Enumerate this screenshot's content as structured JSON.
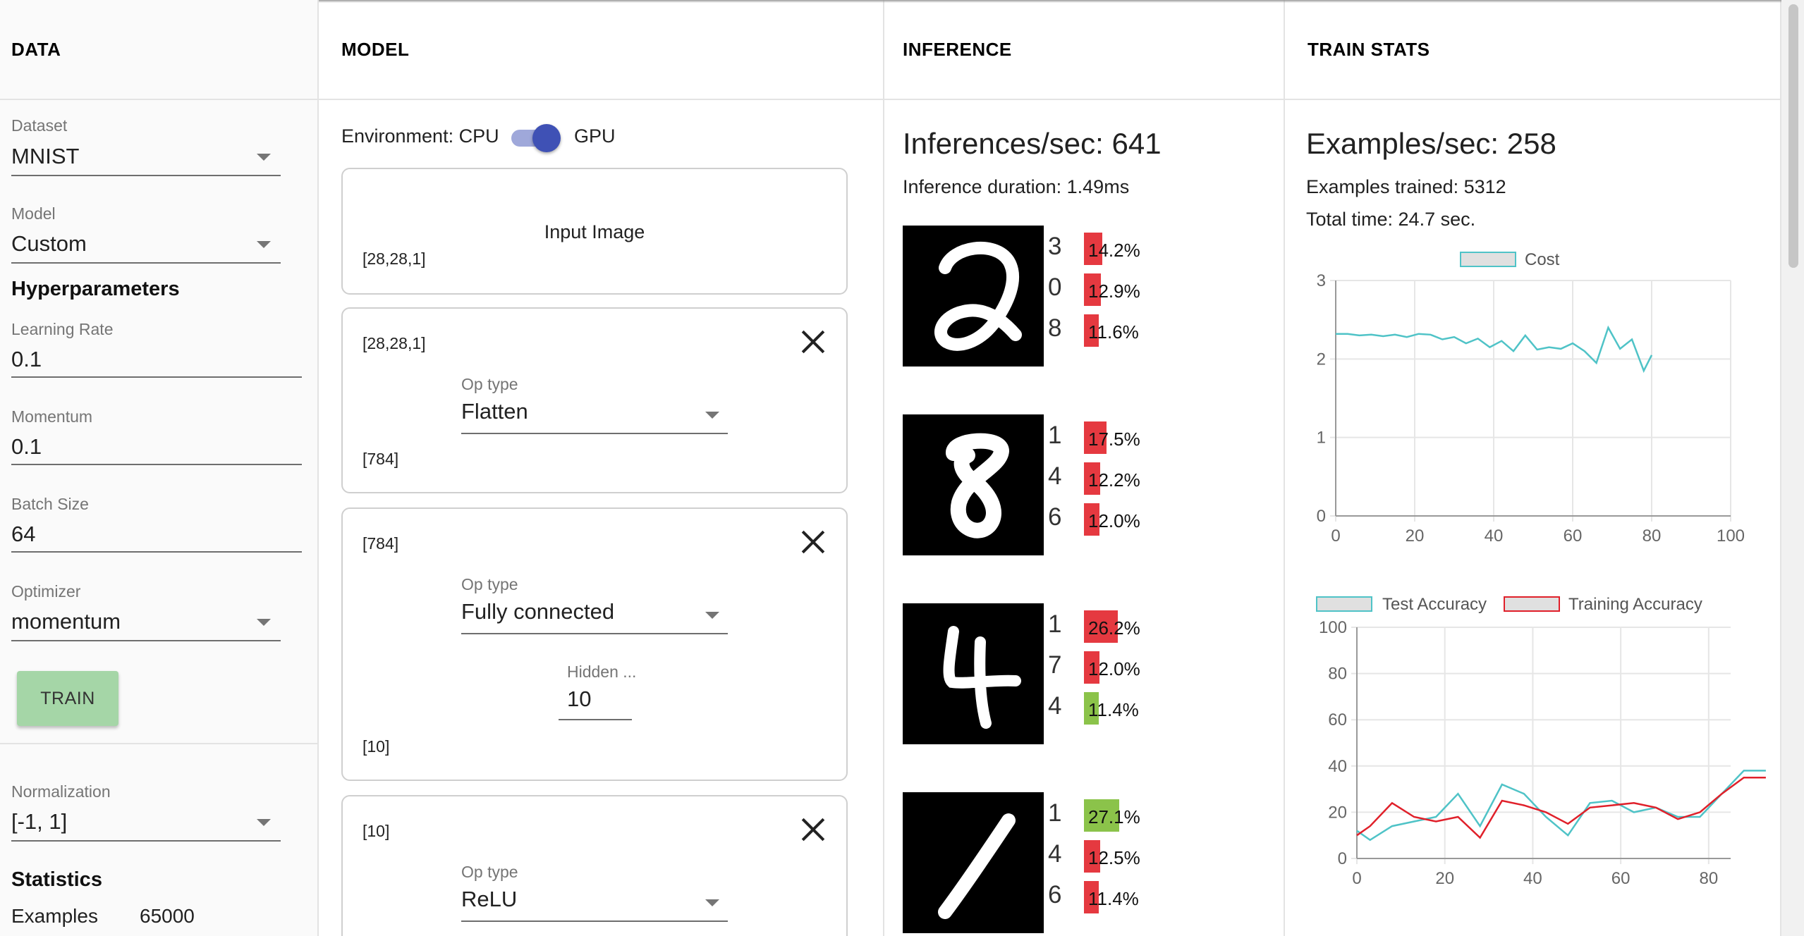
{
  "data_panel": {
    "header": "DATA",
    "dataset": {
      "label": "Dataset",
      "value": "MNIST"
    },
    "model": {
      "label": "Model",
      "value": "Custom"
    },
    "hyper_title": "Hyperparameters",
    "learning_rate": {
      "label": "Learning Rate",
      "value": "0.1"
    },
    "momentum": {
      "label": "Momentum",
      "value": "0.1"
    },
    "batch_size": {
      "label": "Batch Size",
      "value": "64"
    },
    "optimizer": {
      "label": "Optimizer",
      "value": "momentum"
    },
    "train_button": "TRAIN",
    "normalization": {
      "label": "Normalization",
      "value": "[-1, 1]"
    },
    "statistics_title": "Statistics",
    "examples": {
      "label": "Examples",
      "value": "65000"
    }
  },
  "model_panel": {
    "header": "MODEL",
    "environment": {
      "label": "Environment: CPU",
      "alt": "GPU",
      "gpu_on": true
    },
    "input_card": {
      "title": "Input Image",
      "shape": "[28,28,1]"
    },
    "layers": [
      {
        "in_shape": "[28,28,1]",
        "op_label": "Op type",
        "op_value": "Flatten",
        "out_shape": "[784]"
      },
      {
        "in_shape": "[784]",
        "op_label": "Op type",
        "op_value": "Fully connected",
        "hidden_label": "Hidden ...",
        "hidden_value": "10",
        "out_shape": "[10]"
      },
      {
        "in_shape": "[10]",
        "op_label": "Op type",
        "op_value": "ReLU"
      }
    ]
  },
  "inference_panel": {
    "header": "INFERENCE",
    "inferences_per_sec": "Inferences/sec: 641",
    "duration": "Inference duration: 1.49ms",
    "samples": [
      {
        "digit": "2",
        "preds": [
          {
            "label": "3",
            "pct": "14.2%",
            "p": 0.142,
            "correct": false
          },
          {
            "label": "0",
            "pct": "12.9%",
            "p": 0.129,
            "correct": false
          },
          {
            "label": "8",
            "pct": "11.6%",
            "p": 0.116,
            "correct": false
          }
        ]
      },
      {
        "digit": "8",
        "preds": [
          {
            "label": "1",
            "pct": "17.5%",
            "p": 0.175,
            "correct": false
          },
          {
            "label": "4",
            "pct": "12.2%",
            "p": 0.122,
            "correct": false
          },
          {
            "label": "6",
            "pct": "12.0%",
            "p": 0.12,
            "correct": false
          }
        ]
      },
      {
        "digit": "4",
        "preds": [
          {
            "label": "1",
            "pct": "26.2%",
            "p": 0.262,
            "correct": false
          },
          {
            "label": "7",
            "pct": "12.0%",
            "p": 0.12,
            "correct": false
          },
          {
            "label": "4",
            "pct": "11.4%",
            "p": 0.114,
            "correct": true
          }
        ]
      },
      {
        "digit": "1",
        "preds": [
          {
            "label": "1",
            "pct": "27.1%",
            "p": 0.271,
            "correct": true
          },
          {
            "label": "4",
            "pct": "12.5%",
            "p": 0.125,
            "correct": false
          },
          {
            "label": "6",
            "pct": "11.4%",
            "p": 0.114,
            "correct": false
          }
        ]
      }
    ],
    "colors": {
      "wrong": "#e53940",
      "right": "#8bc34a"
    }
  },
  "train_panel": {
    "header": "TRAIN STATS",
    "examples_per_sec": "Examples/sec: 258",
    "examples_trained": "Examples trained: 5312",
    "total_time": "Total time: 24.7 sec."
  },
  "chart_data": [
    {
      "type": "line",
      "series": [
        {
          "name": "Cost",
          "color": "#4fc3c7",
          "x": [
            0,
            3,
            6,
            9,
            12,
            15,
            18,
            21,
            24,
            27,
            30,
            33,
            36,
            39,
            42,
            45,
            48,
            51,
            54,
            57,
            60,
            63,
            66,
            69,
            72,
            75,
            78,
            80
          ],
          "y": [
            2.32,
            2.32,
            2.3,
            2.31,
            2.29,
            2.31,
            2.28,
            2.32,
            2.31,
            2.25,
            2.28,
            2.2,
            2.26,
            2.15,
            2.23,
            2.1,
            2.3,
            2.12,
            2.15,
            2.13,
            2.2,
            2.1,
            1.95,
            2.4,
            2.13,
            2.25,
            1.85,
            2.05
          ]
        }
      ],
      "xlim": [
        0,
        100
      ],
      "ylim": [
        0,
        3
      ],
      "xticks": [
        "0",
        "20",
        "40",
        "60",
        "80",
        "100"
      ],
      "yticks": [
        "0",
        "1",
        "2",
        "3"
      ],
      "legend": "top-center",
      "grid": true
    },
    {
      "type": "line",
      "series": [
        {
          "name": "Test Accuracy",
          "color": "#4fc3c7",
          "x": [
            0,
            3,
            8,
            13,
            18,
            23,
            28,
            33,
            38,
            43,
            48,
            53,
            58,
            63,
            68,
            73,
            78,
            83,
            88,
            93
          ],
          "y": [
            12,
            8,
            14,
            16,
            18,
            28,
            14,
            32,
            28,
            18,
            10,
            24,
            25,
            20,
            22,
            18,
            18,
            28,
            38,
            38
          ]
        },
        {
          "name": "Training Accuracy",
          "color": "#e0202a",
          "x": [
            0,
            3,
            8,
            13,
            18,
            23,
            28,
            33,
            38,
            43,
            48,
            53,
            58,
            63,
            68,
            73,
            78,
            83,
            88,
            93
          ],
          "y": [
            10,
            14,
            24,
            18,
            16,
            18,
            9,
            25,
            23,
            20,
            15,
            22,
            23,
            24,
            22,
            17,
            20,
            28,
            35,
            35
          ]
        }
      ],
      "xlim": [
        0,
        85
      ],
      "ylim": [
        0,
        100
      ],
      "xticks": [
        "0",
        "20",
        "40",
        "60",
        "80"
      ],
      "yticks": [
        "0",
        "20",
        "40",
        "60",
        "80",
        "100"
      ],
      "legend": "top-center",
      "grid": true
    }
  ]
}
